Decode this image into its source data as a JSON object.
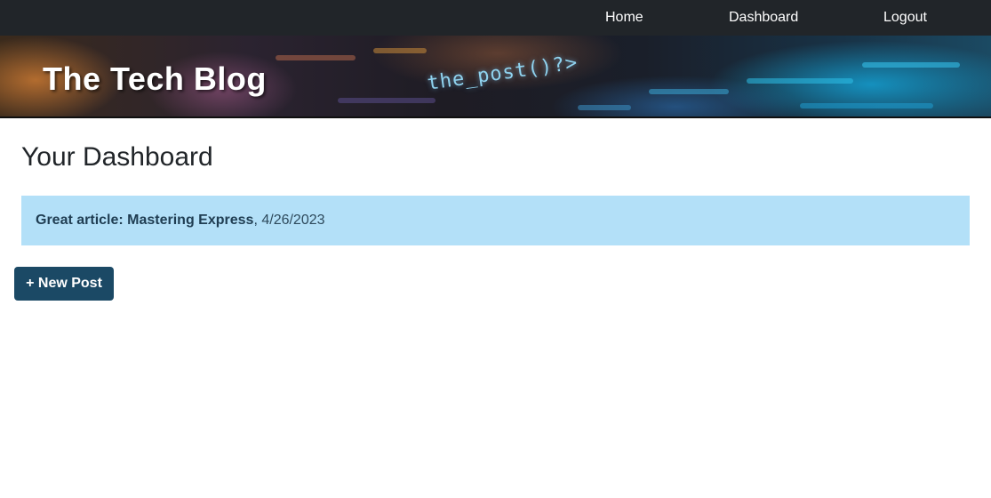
{
  "nav": {
    "items": [
      {
        "label": "Home"
      },
      {
        "label": "Dashboard"
      },
      {
        "label": "Logout"
      }
    ]
  },
  "banner": {
    "title": "The Tech Blog",
    "code_text": "the_post()?>"
  },
  "main": {
    "title": "Your Dashboard",
    "posts": [
      {
        "title": "Great article: Mastering Express",
        "separator": ",",
        "date": "4/26/2023"
      }
    ],
    "new_post_label": "+ New Post"
  },
  "colors": {
    "nav_bg": "#212529",
    "post_card_bg": "#b3e0f8",
    "button_bg": "#1b4965"
  }
}
